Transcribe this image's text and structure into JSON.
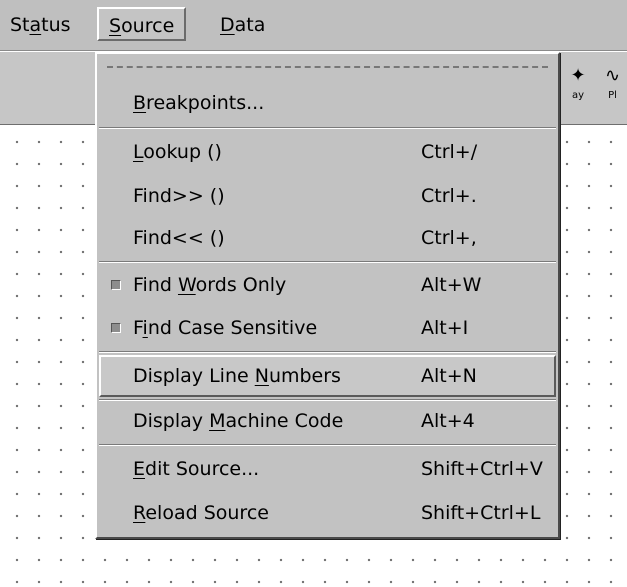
{
  "menubar": {
    "status": {
      "pre": "St",
      "u": "a",
      "post": "tus"
    },
    "source": {
      "pre": "",
      "u": "S",
      "post": "ource"
    },
    "data": {
      "pre": "",
      "u": "D",
      "post": "ata"
    }
  },
  "toolbar": {
    "display_label": "ay",
    "plot_label": "Pl"
  },
  "menu": {
    "items": [
      {
        "pre": "",
        "u": "B",
        "post": "reakpoints...",
        "accel": ""
      },
      {
        "pre": "",
        "u": "L",
        "post": "ookup ()",
        "accel": "Ctrl+/"
      },
      {
        "pre": "Find>> ()",
        "u": "",
        "post": "",
        "accel": "Ctrl+."
      },
      {
        "pre": "Find<< ()",
        "u": "",
        "post": "",
        "accel": "Ctrl+,"
      },
      {
        "pre": "Find ",
        "u": "W",
        "post": "ords Only",
        "accel": "Alt+W",
        "checked": true
      },
      {
        "pre": "F",
        "u": "i",
        "post": "nd Case Sensitive",
        "accel": "Alt+I",
        "checked": true
      },
      {
        "pre": "Display Line ",
        "u": "N",
        "post": "umbers",
        "accel": "Alt+N",
        "active": true
      },
      {
        "pre": "Display ",
        "u": "M",
        "post": "achine Code",
        "accel": "Alt+4"
      },
      {
        "pre": "",
        "u": "E",
        "post": "dit Source...",
        "accel": "Shift+Ctrl+V"
      },
      {
        "pre": "",
        "u": "R",
        "post": "eload Source",
        "accel": "Shift+Ctrl+L"
      }
    ]
  }
}
